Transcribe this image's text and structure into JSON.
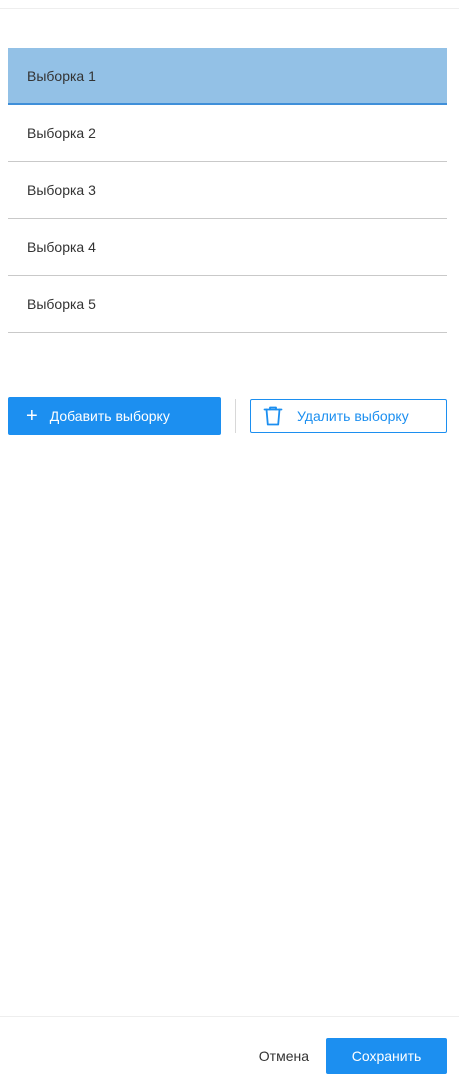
{
  "samples": {
    "items": [
      {
        "label": "Выборка 1",
        "selected": true
      },
      {
        "label": "Выборка 2",
        "selected": false
      },
      {
        "label": "Выборка 3",
        "selected": false
      },
      {
        "label": "Выборка 4",
        "selected": false
      },
      {
        "label": "Выборка 5",
        "selected": false
      }
    ]
  },
  "actions": {
    "add_label": "Добавить выборку",
    "add_icon": "plus-icon",
    "delete_label": "Удалить выборку",
    "delete_icon": "trash-icon"
  },
  "footer": {
    "cancel_label": "Отмена",
    "save_label": "Сохранить"
  },
  "colors": {
    "accent": "#1c8ff0",
    "selected_bg": "#93c1e6",
    "selected_border": "#3f8fd9"
  }
}
